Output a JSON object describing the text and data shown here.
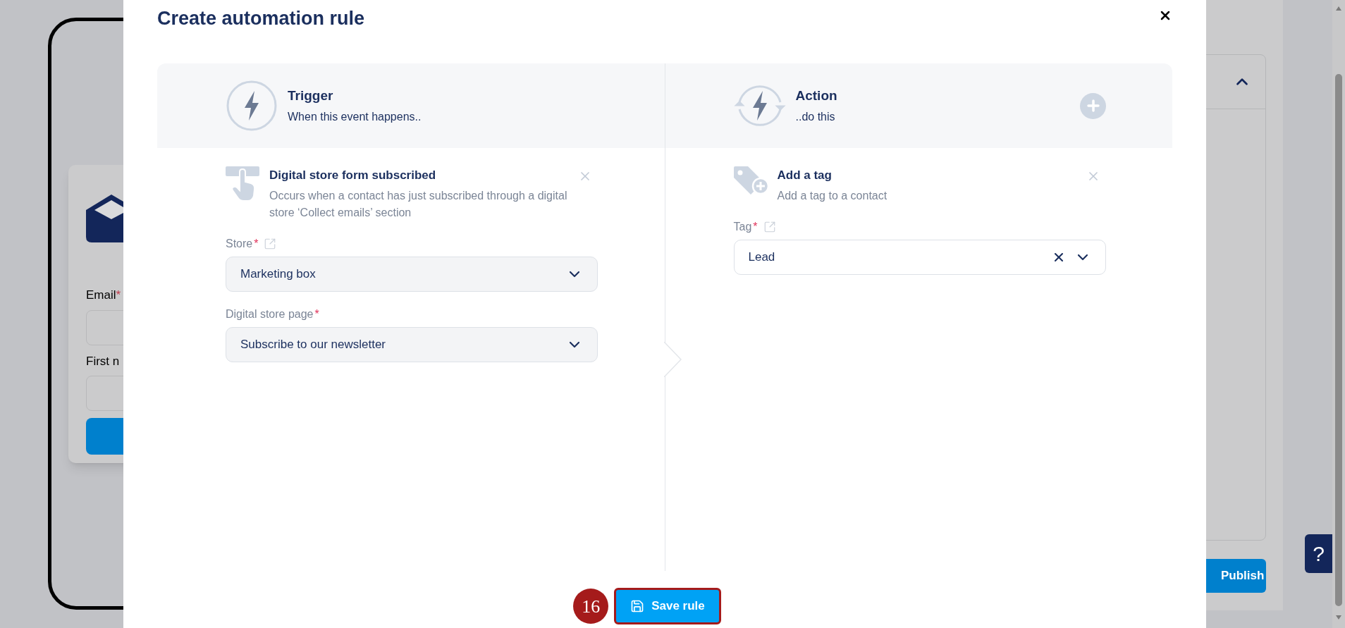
{
  "background": {
    "form_fields": [
      {
        "label": "Email",
        "required_mark": "*"
      },
      {
        "label": "First n"
      }
    ],
    "publish_button": "Publish",
    "help_button": "?"
  },
  "modal": {
    "title": "Create automation rule",
    "trigger": {
      "title": "Trigger",
      "subtitle": "When this event happens.."
    },
    "action": {
      "title": "Action",
      "subtitle": "..do this"
    },
    "trigger_item": {
      "title": "Digital store form subscribed",
      "description": "Occurs when a contact has just subscribed through a digital store ‘Collect emails’ section",
      "fields": [
        {
          "label": "Store",
          "required_mark": "*",
          "link": true,
          "value": "Marketing box",
          "clearable": false
        },
        {
          "label": "Digital store page",
          "required_mark": "*",
          "link": false,
          "value": "Subscribe to our newsletter",
          "clearable": false
        }
      ]
    },
    "action_item": {
      "title": "Add a tag",
      "description": "Add a tag to a contact",
      "fields": [
        {
          "label": "Tag",
          "required_mark": "*",
          "link": true,
          "value": "Lead",
          "clearable": true
        }
      ]
    },
    "save_button": "Save rule",
    "step_badge": "16"
  }
}
